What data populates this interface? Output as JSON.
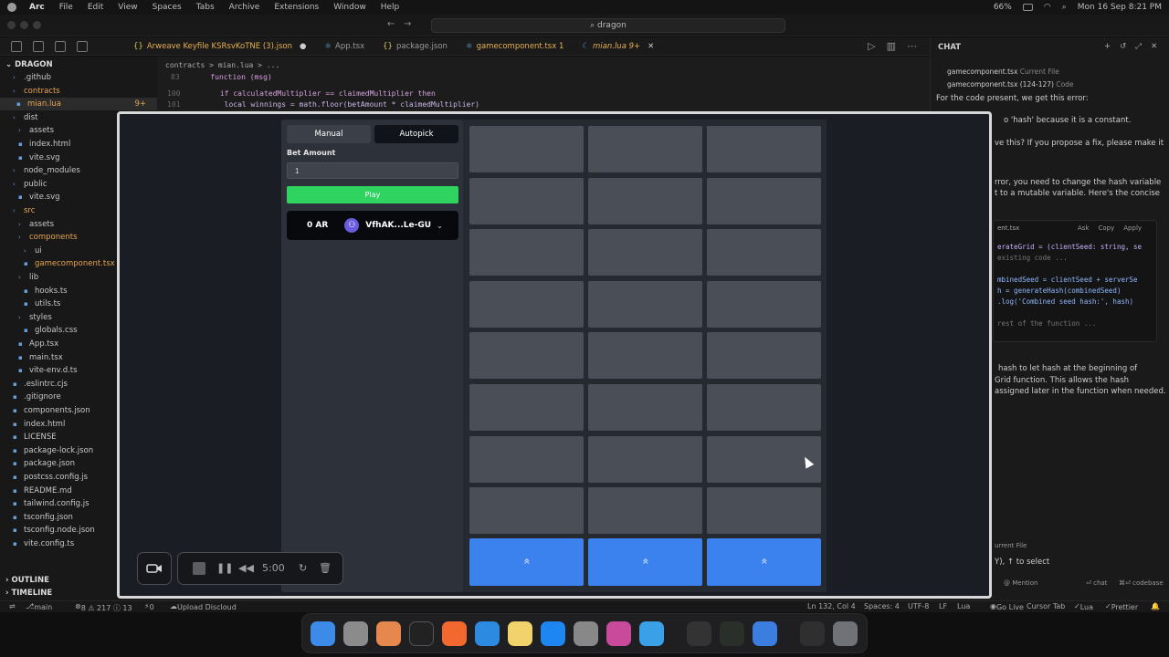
{
  "menubar": {
    "items": [
      "Arc",
      "File",
      "Edit",
      "View",
      "Spaces",
      "Tabs",
      "Archive",
      "Extensions",
      "Window",
      "Help"
    ],
    "battery": "66%",
    "datetime": "Mon 16 Sep 8:21 PM"
  },
  "editor_window": {
    "search_text": "dragon",
    "tabs": [
      {
        "label": "Arweave Keyfile KSRsvKoTNE (3).json",
        "state": "modified"
      },
      {
        "label": "App.tsx",
        "state": "normal"
      },
      {
        "label": "package.json",
        "state": "normal"
      },
      {
        "label": "gamecomponent.tsx 1",
        "state": "warn"
      },
      {
        "label": "mian.lua 9+",
        "state": "active"
      }
    ],
    "breadcrumb": "contracts > mian.lua > ...",
    "code_lines": [
      {
        "num": "83",
        "text": "function (msg)"
      },
      {
        "num": "100",
        "text": "if calculatedMultiplier == claimedMultiplier then"
      },
      {
        "num": "101",
        "text": "local winnings = math.floor(betAmount * claimedMultiplier)"
      }
    ]
  },
  "explorer": {
    "root": "DRAGON",
    "items": [
      {
        "label": ".github",
        "type": "folder"
      },
      {
        "label": "contracts",
        "type": "folder",
        "color": "orange"
      },
      {
        "label": "mian.lua",
        "type": "file",
        "color": "orange",
        "badge": "9+",
        "selected": true
      },
      {
        "label": "dist",
        "type": "folder"
      },
      {
        "label": "assets",
        "type": "folder"
      },
      {
        "label": "index.html",
        "type": "file"
      },
      {
        "label": "vite.svg",
        "type": "file"
      },
      {
        "label": "node_modules",
        "type": "folder"
      },
      {
        "label": "public",
        "type": "folder"
      },
      {
        "label": "vite.svg",
        "type": "file"
      },
      {
        "label": "src",
        "type": "folder",
        "color": "orange"
      },
      {
        "label": "assets",
        "type": "folder"
      },
      {
        "label": "components",
        "type": "folder",
        "color": "orange"
      },
      {
        "label": "ui",
        "type": "folder"
      },
      {
        "label": "gamecomponent.tsx",
        "type": "file",
        "color": "orange"
      },
      {
        "label": "lib",
        "type": "folder"
      },
      {
        "label": "hooks.ts",
        "type": "file"
      },
      {
        "label": "utils.ts",
        "type": "file"
      },
      {
        "label": "styles",
        "type": "folder"
      },
      {
        "label": "globals.css",
        "type": "file"
      },
      {
        "label": "App.tsx",
        "type": "file"
      },
      {
        "label": "main.tsx",
        "type": "file"
      },
      {
        "label": "vite-env.d.ts",
        "type": "file"
      },
      {
        "label": ".eslintrc.cjs",
        "type": "file"
      },
      {
        "label": ".gitignore",
        "type": "file"
      },
      {
        "label": "components.json",
        "type": "file"
      },
      {
        "label": "index.html",
        "type": "file"
      },
      {
        "label": "LICENSE",
        "type": "file"
      },
      {
        "label": "package-lock.json",
        "type": "file"
      },
      {
        "label": "package.json",
        "type": "file"
      },
      {
        "label": "postcss.config.js",
        "type": "file"
      },
      {
        "label": "README.md",
        "type": "file"
      },
      {
        "label": "tailwind.config.js",
        "type": "file"
      },
      {
        "label": "tsconfig.json",
        "type": "file"
      },
      {
        "label": "tsconfig.node.json",
        "type": "file"
      },
      {
        "label": "vite.config.ts",
        "type": "file"
      }
    ],
    "outline_label": "OUTLINE",
    "timeline_label": "TIMELINE"
  },
  "chat": {
    "title": "CHAT",
    "ctx1": "gamecomponent.tsx",
    "ctx1_tag": "Current File",
    "ctx2": "gamecomponent.tsx (124-127)",
    "ctx2_tag": "Code",
    "prompt": "For the code present, we get this error:",
    "line_a": "o 'hash' because it is a constant.",
    "line_b": "ve this? If you propose a fix, please make it",
    "line_c": "rror, you need to change the  hash  variable",
    "line_d": "t to a mutable variable. Here's the concise",
    "code_file": "ent.tsx",
    "code_actions": [
      "Ask",
      "Copy",
      "Apply"
    ],
    "code": [
      "erateGrid = (clientSeed: string, se",
      "existing code ...",
      "",
      "mbinedSeed = clientSeed + serverSe",
      "h = generateHash(combinedSeed)",
      ".log('Combined seed hash:', hash)",
      "",
      "rest of the function ..."
    ],
    "explain_1": "hash  to  let hash  at the beginning of",
    "explain_2": "Grid  function. This allows the  hash",
    "explain_3": "assigned later in the function when needed.",
    "input_file_tag": "urrent File",
    "input_hint": "Y), ↑ to select",
    "mention": "Mention",
    "footer_chat": "chat",
    "footer_codebase": "codebase"
  },
  "statusbar": {
    "branch": "main",
    "problems": "8 ⚠ 217 ⓘ 13",
    "ports": "0",
    "upload": "Upload Discloud",
    "position": "Ln 132, Col 4",
    "spaces": "Spaces: 4",
    "encoding": "UTF-8",
    "eol": "LF",
    "language": "Lua",
    "golive": "Go Live",
    "cursor_tab": "Cursor Tab",
    "lua": "Lua",
    "prettier": "Prettier"
  },
  "game": {
    "mode_tabs": [
      "Manual",
      "Autopick"
    ],
    "active_mode": "Autopick",
    "bet_label": "Bet Amount",
    "bet_value": "1",
    "play_label": "Play",
    "balance": "0 AR",
    "wallet_address": "VfhAK...Le-GU",
    "grid_rows": 8,
    "grid_cols": 3,
    "pick_label": "»",
    "colors": {
      "cell": "#4a4f57",
      "pick": "#3b82ee",
      "play": "#2fd35f"
    }
  },
  "recorder": {
    "timer": "5:00"
  }
}
